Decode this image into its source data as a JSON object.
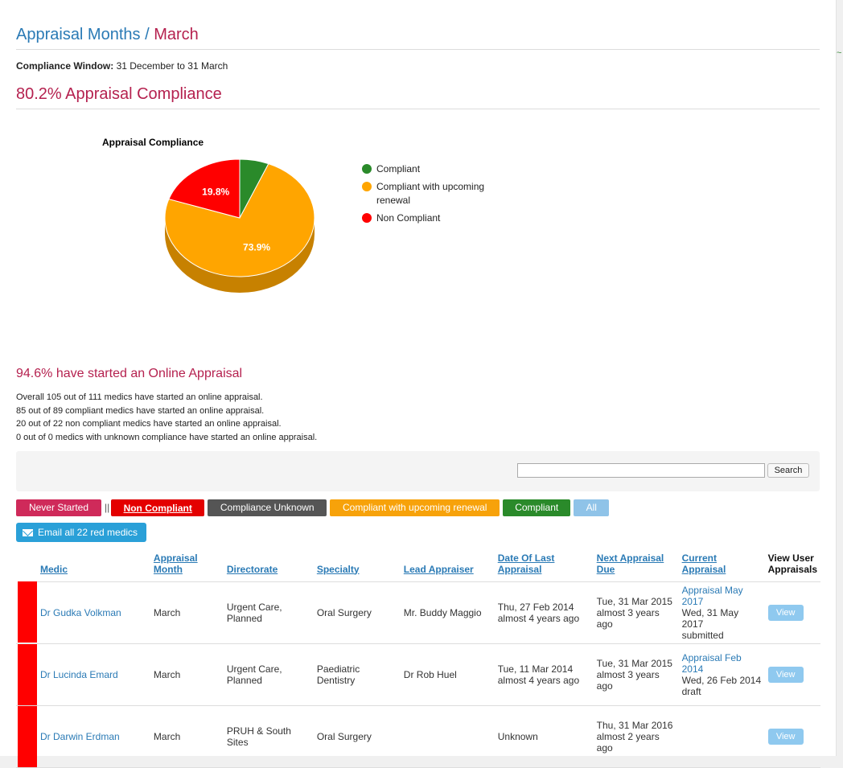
{
  "breadcrumb": {
    "parent": "Appraisal Months",
    "separator": "/",
    "current": "March"
  },
  "compliance_window": {
    "label": "Compliance Window:",
    "value": "31 December to 31 March"
  },
  "compliance_heading": "80.2% Appraisal Compliance",
  "chart_data": {
    "type": "pie",
    "title": "Appraisal Compliance",
    "slices": [
      {
        "name": "Compliant",
        "value": 6.3,
        "color": "#2a8a2a",
        "label": ""
      },
      {
        "name": "Compliant with upcoming renewal",
        "value": 73.9,
        "color": "#ffa500",
        "label": "73.9%"
      },
      {
        "name": "Non Compliant",
        "value": 19.8,
        "color": "#ff0000",
        "label": "19.8%"
      }
    ],
    "legend": [
      "Compliant",
      "Compliant with upcoming renewal",
      "Non Compliant"
    ],
    "legend_position": "right"
  },
  "started_heading": "94.6% have started an Online Appraisal",
  "stats": [
    "Overall 105 out of 111 medics have started an online appraisal.",
    "85 out of 89 compliant medics have started an online appraisal.",
    "20 out of 22 non compliant medics have started an online appraisal.",
    "0 out of 0 medics with unknown compliance have started an online appraisal."
  ],
  "search": {
    "button": "Search",
    "value": ""
  },
  "filters": {
    "never_started": "Never Started",
    "separator": "||",
    "non_compliant": "Non Compliant",
    "compliance_unknown": "Compliance Unknown",
    "upcoming_renewal": "Compliant with upcoming renewal",
    "compliant": "Compliant",
    "all": "All"
  },
  "email_button": "Email all 22 red medics",
  "table": {
    "headers": {
      "medic": "Medic",
      "appraisal_month": "Appraisal Month",
      "directorate": "Directorate",
      "specialty": "Specialty",
      "lead_appraiser": "Lead Appraiser",
      "date_last": "Date Of Last Appraisal",
      "next_due": "Next Appraisal Due",
      "current": "Current Appraisal",
      "view_user": "View User Appraisals"
    },
    "rows": [
      {
        "status_color": "#ff0000",
        "medic": "Dr Gudka Volkman",
        "month": "March",
        "directorate": "Urgent Care, Planned",
        "specialty": "Oral Surgery",
        "lead": "Mr. Buddy Maggio",
        "last_date": "Thu, 27 Feb 2014",
        "last_ago": "almost 4 years ago",
        "next_date": "Tue, 31 Mar 2015",
        "next_ago": "almost 3 years ago",
        "current_link": "Appraisal May 2017",
        "current_date": "Wed, 31 May 2017",
        "current_status": "submitted",
        "view": "View"
      },
      {
        "status_color": "#ff0000",
        "medic": "Dr Lucinda Emard",
        "month": "March",
        "directorate": "Urgent Care, Planned",
        "specialty": "Paediatric Dentistry",
        "lead": "Dr Rob Huel",
        "last_date": "Tue, 11 Mar 2014",
        "last_ago": "almost 4 years ago",
        "next_date": "Tue, 31 Mar 2015",
        "next_ago": "almost 3 years ago",
        "current_link": "Appraisal Feb 2014",
        "current_date": "Wed, 26 Feb 2014",
        "current_status": "draft",
        "view": "View"
      },
      {
        "status_color": "#ff0000",
        "medic": "Dr Darwin Erdman",
        "month": "March",
        "directorate": "PRUH & South Sites",
        "specialty": "Oral Surgery",
        "lead": "",
        "last_date": "Unknown",
        "last_ago": "",
        "next_date": "Thu, 31 Mar 2016",
        "next_ago": "almost 2 years ago",
        "current_link": "",
        "current_date": "",
        "current_status": "",
        "view": "View"
      }
    ]
  }
}
